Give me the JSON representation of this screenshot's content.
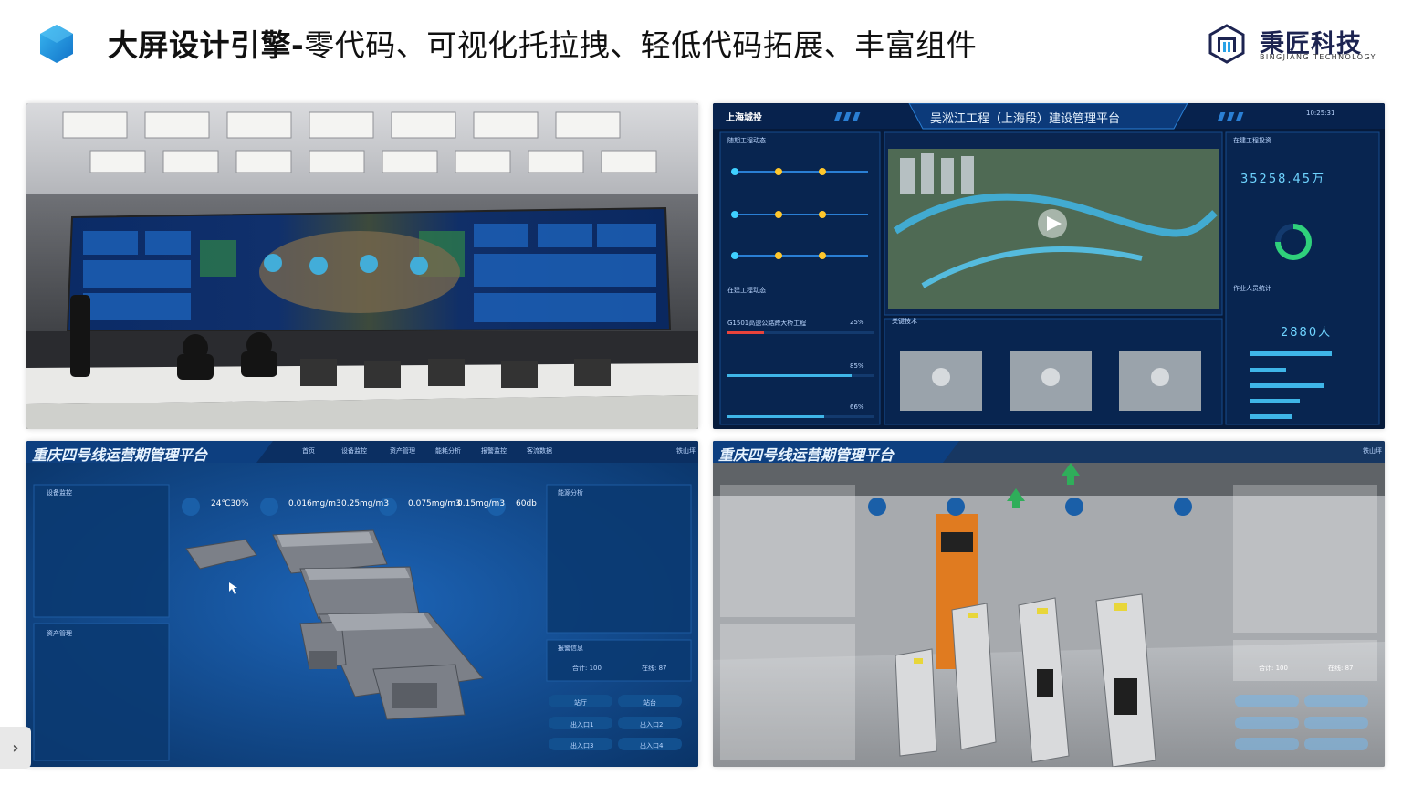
{
  "header": {
    "title_bold": "大屏设计引擎-",
    "title_rest": "零代码、可视化托拉拽、轻低代码拓展、丰富组件"
  },
  "logo": {
    "cn": "秉匠科技",
    "en": "BINGJIANG TECHNOLOGY"
  },
  "colors": {
    "accent": "#1e88d9",
    "hex_icon": "#2aa3e6",
    "dashboard_bg": "#061a3a",
    "platform_blue": "#0a3b78",
    "logo_navy": "#1d2451"
  },
  "panel2": {
    "brand": "上海城投",
    "title": "吴淞江工程（上海段）建设管理平台",
    "time": "10:25:31",
    "left_section1": "随期工程动态",
    "left_section2": "在建工程动态",
    "project1": "G1501高速公路跨大桥工程",
    "project1_pct": "25%",
    "project2_pct": "85%",
    "project3_pct": "66%",
    "mid_section": "关键技术",
    "right_section1": "在建工程投资",
    "invest_value": "35258.45万",
    "right_section2": "作业人员统计",
    "workers_value": "2880人"
  },
  "panel3": {
    "title": "重庆四号线运营期管理平台",
    "nav": [
      "首页",
      "设备监控",
      "资产管理",
      "能耗分析",
      "报警监控",
      "客流数据"
    ],
    "location": "铁山坪",
    "metrics": [
      "24℃30%",
      "0.016mg/m3",
      "0.25mg/m3",
      "0.075mg/m3",
      "0.15mg/m3",
      "60db"
    ],
    "left_section1": "设备监控",
    "left_section2": "资产管理",
    "right_section1": "能源分析",
    "right_section2": "报警信息",
    "alarm_total": "合计: 100",
    "alarm_done": "在线: 87",
    "buttons": [
      "站厅",
      "站台",
      "出入口1",
      "出入口2",
      "出入口3",
      "出入口4"
    ]
  },
  "panel4": {
    "title": "重庆四号线运营期管理平台",
    "location": "铁山坪",
    "alarm_total": "合计: 100",
    "alarm_done": "在线: 87"
  },
  "side_toggle": {
    "icon": "chevron-right-icon",
    "glyph": "›"
  }
}
